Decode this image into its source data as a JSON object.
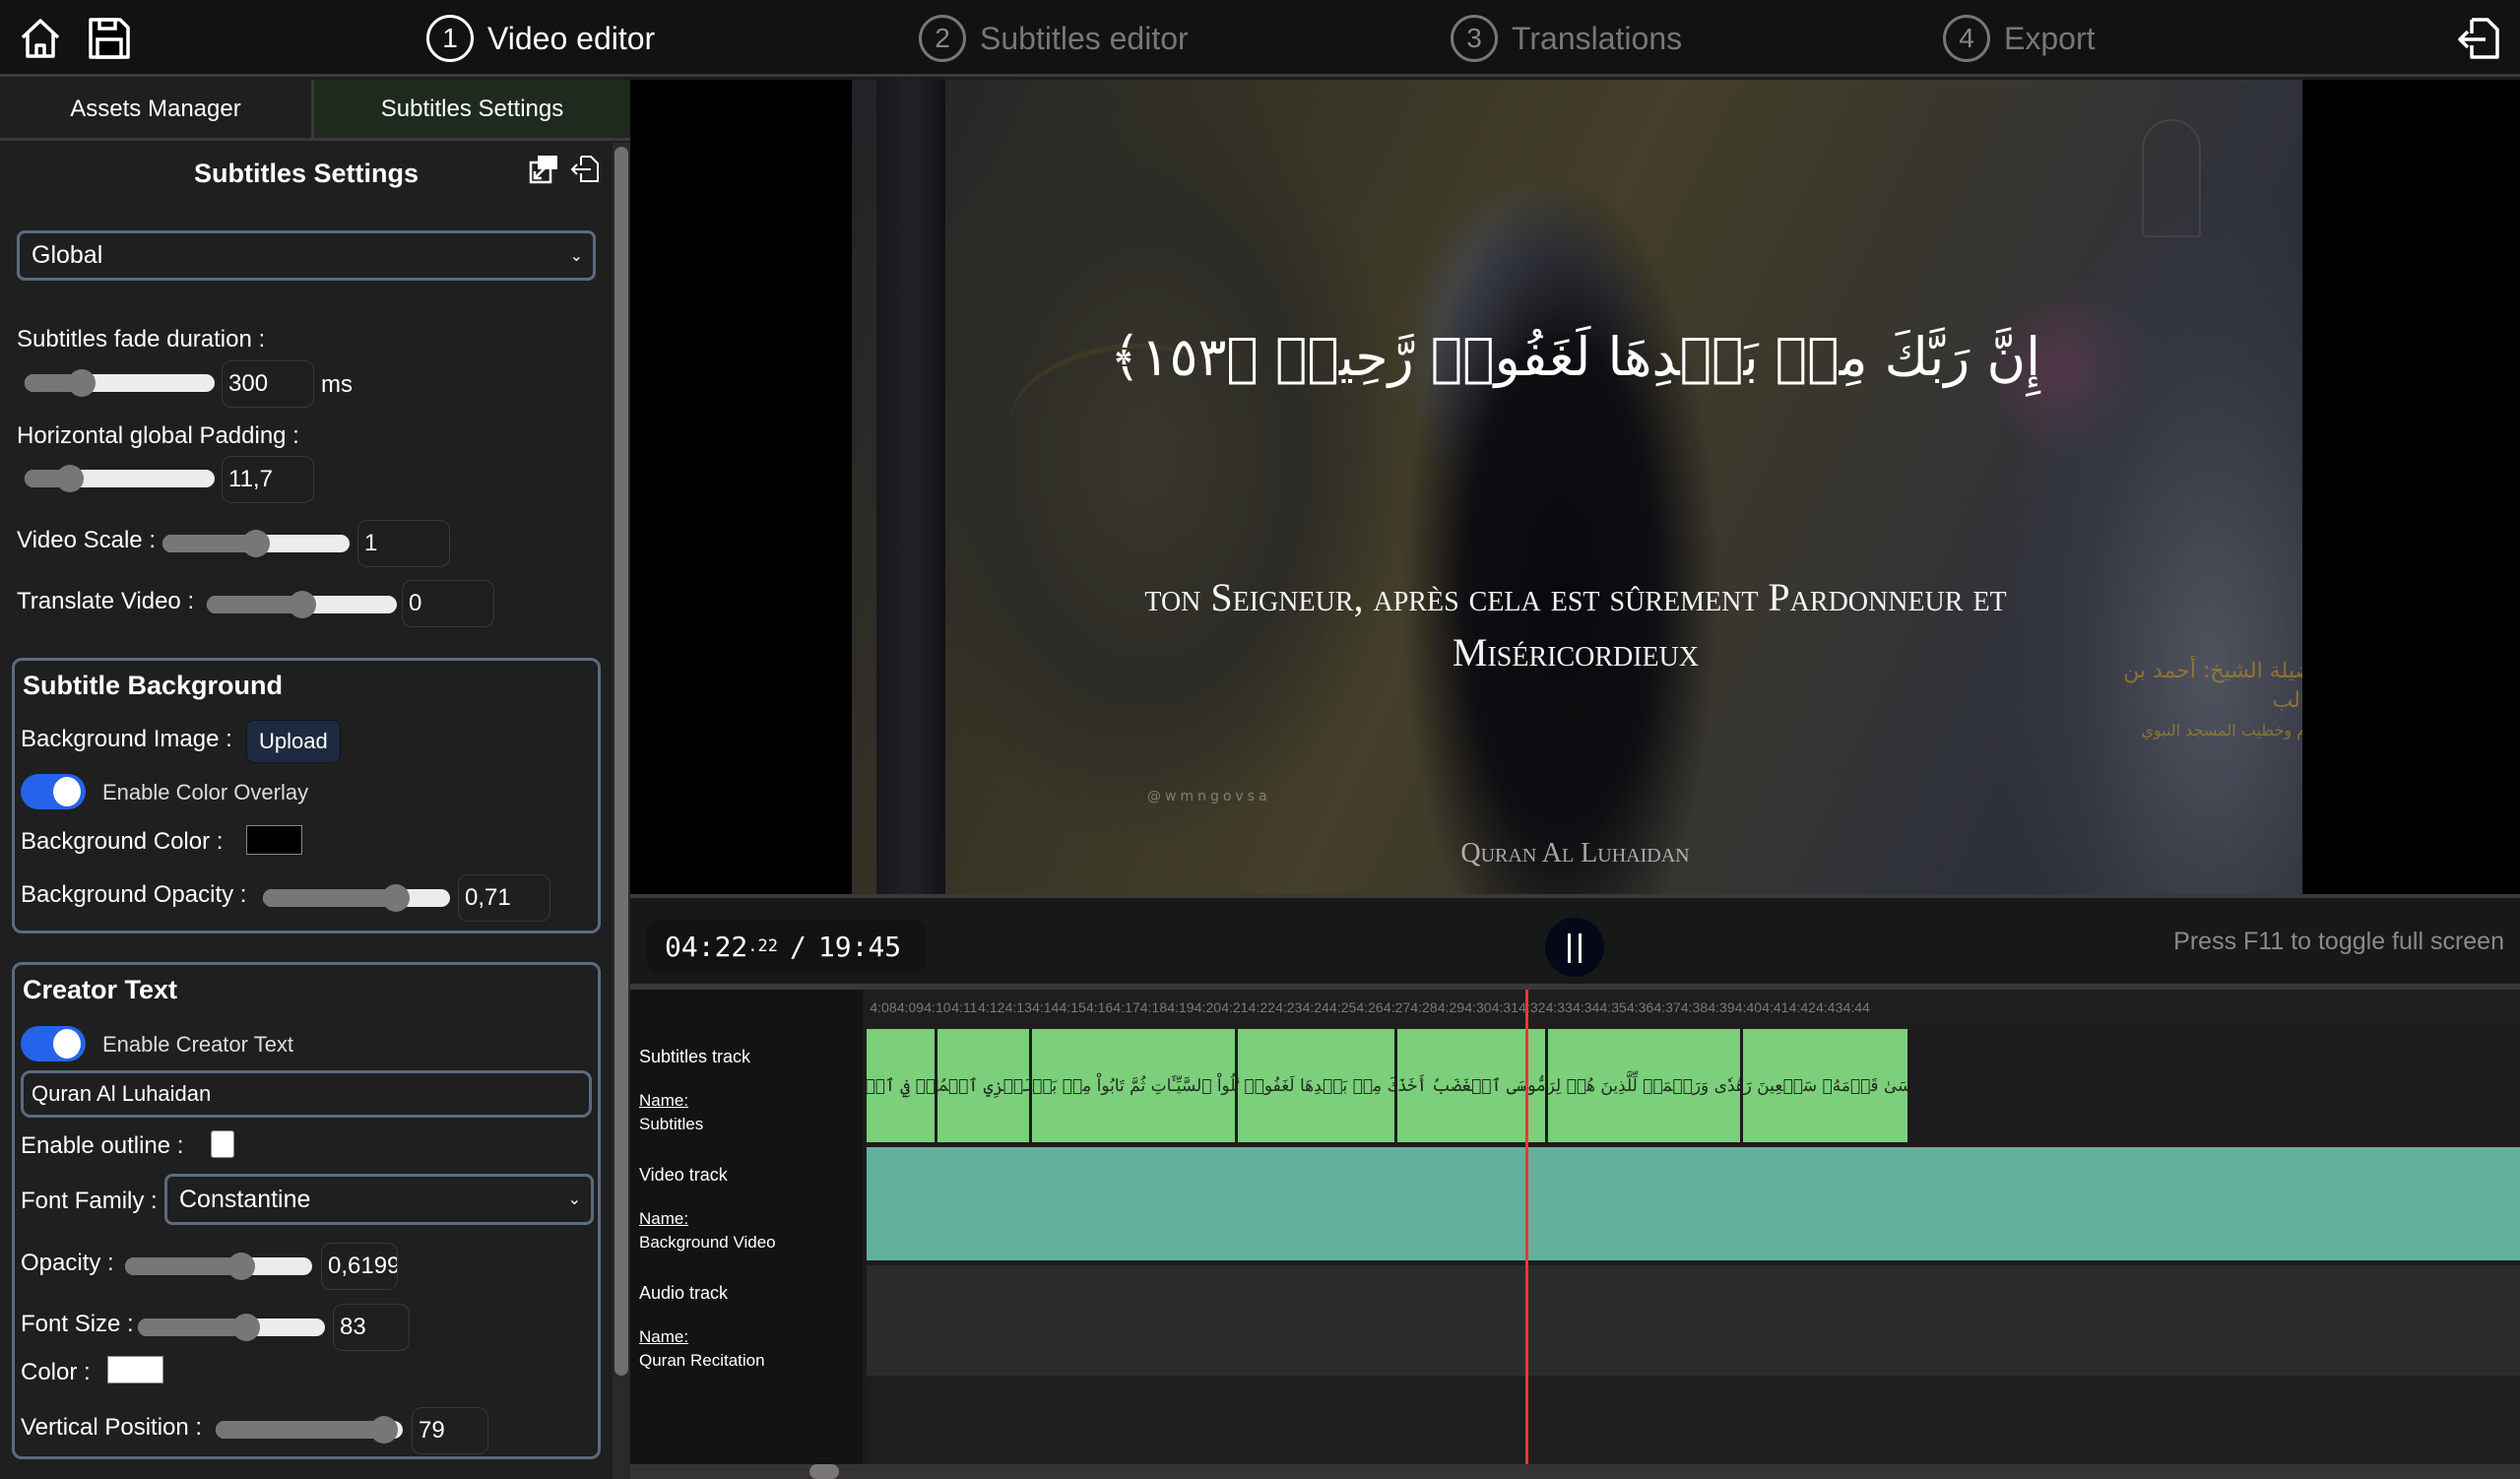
{
  "header": {
    "home_icon": "home-icon",
    "save_icon": "floppy-disk-icon",
    "logout_icon": "exit-door-icon",
    "steps": [
      {
        "number": "1",
        "label": "Video editor",
        "active": true
      },
      {
        "number": "2",
        "label": "Subtitles editor",
        "active": false
      },
      {
        "number": "3",
        "label": "Translations",
        "active": false
      },
      {
        "number": "4",
        "label": "Export",
        "active": false
      }
    ]
  },
  "left_panel": {
    "tabs": [
      {
        "label": "Assets Manager",
        "active": false
      },
      {
        "label": "Subtitles Settings",
        "active": true
      }
    ],
    "title": "Subtitles Settings",
    "icons": [
      "export-settings-icon",
      "import-settings-icon"
    ],
    "scope_select": "Global",
    "fade": {
      "label": "Subtitles fade duration :",
      "value": "300",
      "unit": "ms",
      "fraction": 0.3
    },
    "padding": {
      "label": "Horizontal global Padding :",
      "value": "11,7",
      "fraction": 0.24
    },
    "video_scale": {
      "label": "Video Scale :",
      "value": "1",
      "fraction": 0.5
    },
    "translate_video": {
      "label": "Translate Video :",
      "value": "0",
      "fraction": 0.5
    },
    "subtitle_background": {
      "title": "Subtitle Background",
      "bg_image_label": "Background Image :",
      "upload_label": "Upload",
      "overlay_toggle_label": "Enable Color Overlay",
      "overlay_enabled": true,
      "bg_color_label": "Background Color :",
      "bg_color": "#000000",
      "opacity_label": "Background Opacity :",
      "opacity_value": "0,71",
      "opacity_fraction": 0.71
    },
    "creator_text": {
      "title": "Creator Text",
      "toggle_label": "Enable Creator Text",
      "enabled": true,
      "text_value": "Quran Al Luhaidan",
      "outline_label": "Enable outline :",
      "outline_checked": false,
      "font_family_label": "Font Family :",
      "font_family_value": "Constantine",
      "opacity_label": "Opacity :",
      "opacity_value": "0,6199",
      "opacity_fraction": 0.62,
      "font_size_label": "Font Size :",
      "font_size_value": "83",
      "font_size_fraction": 0.58,
      "color_label": "Color :",
      "color": "#ffffff",
      "vpos_label": "Vertical Position :",
      "vpos_value": "79",
      "vpos_fraction": 0.9
    }
  },
  "preview": {
    "arabic_subtitle": "إِنَّ رَبَّكَ مِنۢ بَعۡدِهَا لَغَفُورٞ رَّحِيمٞ ﴿١٥٣﴾",
    "translation_subtitle": "ton Seigneur, après cela est sûrement Pardonneur et Miséricordieux",
    "creator_text": "Quran Al Luhaidan",
    "watermark_social": "@wmngovsa",
    "watermark_arabic_line1": "فضيلة الشيخ: أحمد بن طالب",
    "watermark_arabic_line2": "إمام وخطيب المسجد النبوي"
  },
  "controls": {
    "current_time": "04:22",
    "current_ms": ".22",
    "separator": "/",
    "total_time": "19:45",
    "pause_icon": "pause-icon",
    "hint": "Press F11 to toggle full screen"
  },
  "timeline": {
    "ruler_ticks": [
      "4:08",
      "4:09",
      "4:10",
      "4:11",
      "4:12",
      "4:13",
      "4:14",
      "4:15",
      "4:16",
      "4:17",
      "4:18",
      "4:19",
      "4:20",
      "4:21",
      "4:22",
      "4:23",
      "4:24",
      "4:25",
      "4:26",
      "4:27",
      "4:28",
      "4:29",
      "4:30",
      "4:31",
      "4:32",
      "4:33",
      "4:34",
      "4:35",
      "4:36",
      "4:37",
      "4:38",
      "4:39",
      "4:40",
      "4:41",
      "4:42",
      "4:43",
      "4:44"
    ],
    "playhead_time": "4:22.22",
    "tracks": [
      {
        "type_label": "Subtitles track",
        "name_label": "Name:",
        "name": "Subtitles"
      },
      {
        "type_label": "Video track",
        "name_label": "Name:",
        "name": "Background Video"
      },
      {
        "type_label": "Audio track",
        "name_label": "Name:",
        "name": "Quran Recitation"
      }
    ],
    "subtitle_clips": [
      {
        "text": "وَذِلَّةٞ فِي ٱلۡحَيَوٰةِ",
        "start": 4.07,
        "end": 4.1
      },
      {
        "text": "وَكَذَٰلِكَ نَجۡزِي ٱلۡمُفۡتَرِينَ",
        "start": 4.1,
        "end": 4.135
      },
      {
        "text": "وَٱلَّذِينَ عَمِلُواْ ٱلسَّيِّـَٔاتِ ثُمَّ تَابُواْ مِنۢ بَعۡدِهَا وَءَامَنُوٓاْ",
        "start": 4.135,
        "end": 4.211
      },
      {
        "text": "إِنَّ رَبَّكَ مِنۢ بَعۡدِهَا لَغَفُورٞ رَّحِيمٞ",
        "start": 4.211,
        "end": 4.27
      },
      {
        "text": "وَلَمَّا سَكَتَ عَن مُّوسَى ٱلۡغَضَبُ أَخَذَ ٱلۡأَلۡوَاحَۖ",
        "start": 4.27,
        "end": 4.326
      },
      {
        "text": "وَفِي نُسۡخَتِهَا هُدٗى وَرَحۡمَةٞ لِّلَّذِينَ هُمۡ لِرَبِّهِمۡ يَرۡهَبُونَ",
        "start": 4.326,
        "end": 4.398
      },
      {
        "text": "وَٱخۡتَارَ مُوسَىٰ قَوۡمَهُۥ سَبۡعِينَ رَجُلٗا لِّمِيقَٰتِنَاۖ",
        "start": 4.398,
        "end": 4.46
      }
    ]
  }
}
